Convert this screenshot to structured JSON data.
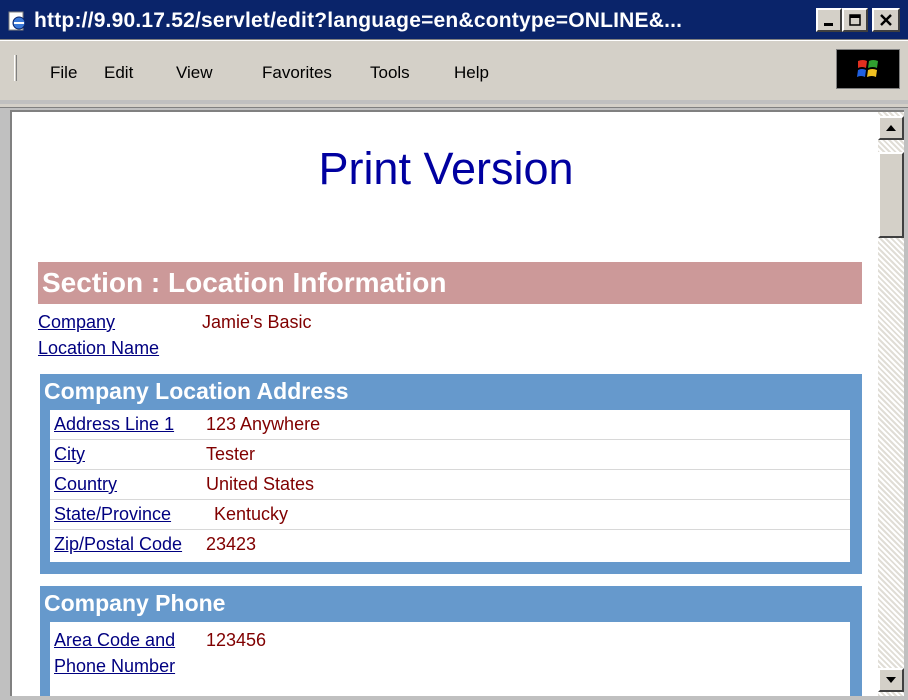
{
  "window": {
    "title": "http://9.90.17.52/servlet/edit?language=en&contype=ONLINE&..."
  },
  "menu": {
    "items": [
      "File",
      "Edit",
      "View",
      "Favorites",
      "Tools",
      "Help"
    ]
  },
  "page": {
    "title": "Print Version",
    "section_header": "Section : Location Information",
    "company_location_name": {
      "label_line1": "Company",
      "label_line2": "Location Name",
      "value": "Jamie's Basic"
    },
    "address_group": {
      "title": "Company Location Address",
      "rows": [
        {
          "label": "Address Line 1",
          "value": "123 Anywhere"
        },
        {
          "label": "City",
          "value": "Tester"
        },
        {
          "label": "Country",
          "value": "United States"
        },
        {
          "label": "State/Province",
          "value": "Kentucky"
        },
        {
          "label": "Zip/Postal Code",
          "value": "23423"
        }
      ]
    },
    "phone_group": {
      "title": "Company Phone",
      "label_line1": "Area Code and",
      "label_line2": "Phone Number",
      "value": "123456"
    }
  },
  "colors": {
    "title_bar": "#0a246a",
    "page_title": "#0000a0",
    "section_header_bg": "#cc9999",
    "group_bg": "#6699cc",
    "label_link": "#000080",
    "value_text": "#800000"
  },
  "icons": {
    "window": "ie-page-icon",
    "minimize": "minimize-icon",
    "maximize": "maximize-icon",
    "close": "close-icon",
    "throbber": "windows-logo-icon",
    "scroll_up": "arrow-up-icon",
    "scroll_down": "arrow-down-icon"
  }
}
